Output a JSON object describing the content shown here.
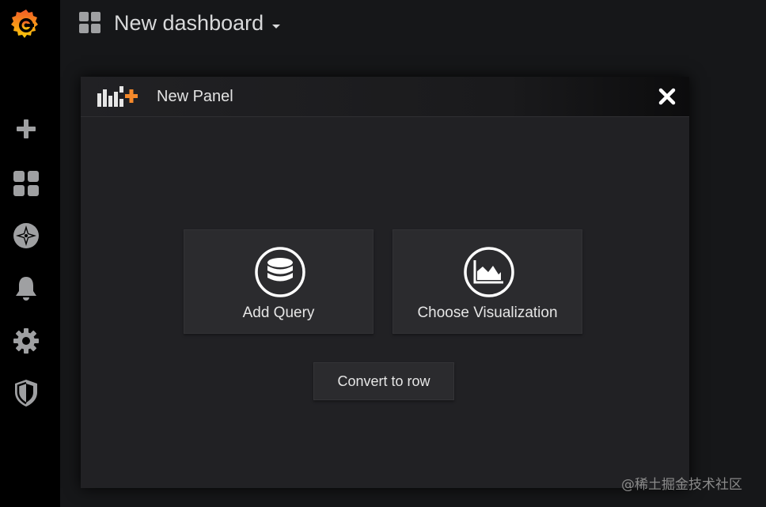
{
  "sidebar": {
    "items": [
      {
        "name": "plus-icon",
        "label": "Create"
      },
      {
        "name": "dashboards-icon",
        "label": "Dashboards"
      },
      {
        "name": "explore-compass-icon",
        "label": "Explore"
      },
      {
        "name": "bell-icon",
        "label": "Alerting"
      },
      {
        "name": "gear-icon",
        "label": "Configuration"
      },
      {
        "name": "shield-icon",
        "label": "Server Admin"
      }
    ]
  },
  "header": {
    "title": "New dashboard"
  },
  "panel": {
    "title": "New Panel",
    "actions": {
      "add_query": "Add Query",
      "choose_visualization": "Choose Visualization",
      "convert_to_row": "Convert to row"
    }
  },
  "colors": {
    "brand_orange": "#f5892b",
    "sidebar_bg": "#000000",
    "page_bg": "#161719",
    "panel_bg": "#212124",
    "card_bg": "#2b2b2e"
  },
  "watermark": "@稀土掘金技术社区"
}
